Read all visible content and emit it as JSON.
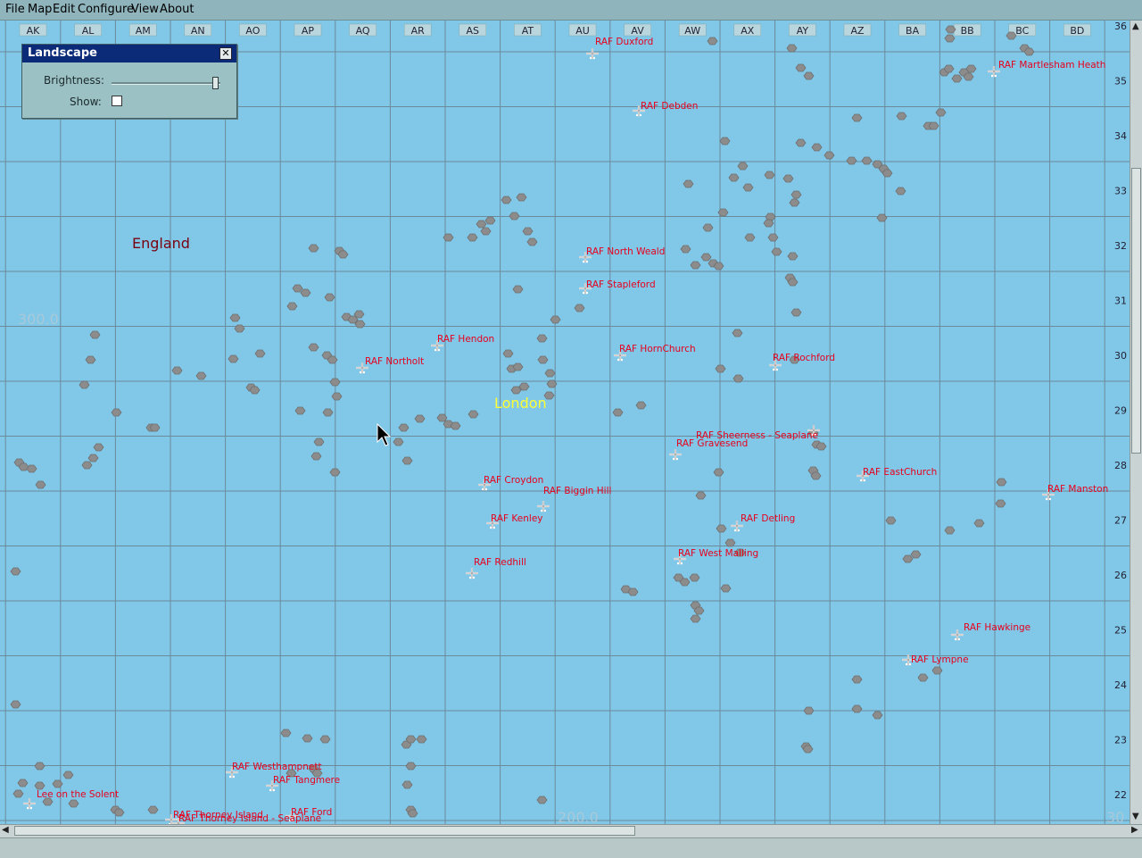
{
  "menu": [
    "File",
    "Map",
    "Edit",
    "Configure",
    "View",
    "About"
  ],
  "grid": {
    "columns": [
      "AK",
      "AL",
      "AM",
      "AN",
      "AO",
      "AP",
      "AQ",
      "AR",
      "AS",
      "AT",
      "AU",
      "AV",
      "AW",
      "AX",
      "AY",
      "AZ",
      "BA",
      "BB",
      "BC",
      "BD"
    ],
    "rows": [
      "36",
      "35",
      "34",
      "33",
      "32",
      "31",
      "30",
      "29",
      "28",
      "27",
      "26",
      "25",
      "24",
      "23",
      "22"
    ],
    "coord_labels": [
      "300.0",
      "200.0",
      "30"
    ]
  },
  "regions": [
    {
      "name": "England",
      "color": "#7a0010"
    },
    {
      "name": "London",
      "color": "#ffff33"
    }
  ],
  "airfields": [
    {
      "name": "RAF Duxford"
    },
    {
      "name": "RAF Martlesham Heath"
    },
    {
      "name": "RAF Debden"
    },
    {
      "name": "RAF North Weald"
    },
    {
      "name": "RAF Stapleford"
    },
    {
      "name": "RAF Hendon"
    },
    {
      "name": "RAF Northolt"
    },
    {
      "name": "RAF HornChurch"
    },
    {
      "name": "RAF Rochford"
    },
    {
      "name": "RAF Sheerness - Seaplane"
    },
    {
      "name": "RAF Gravesend"
    },
    {
      "name": "RAF Croydon"
    },
    {
      "name": "RAF Biggin Hill"
    },
    {
      "name": "RAF EastChurch"
    },
    {
      "name": "RAF Manston"
    },
    {
      "name": "RAF Kenley"
    },
    {
      "name": "RAF Detling"
    },
    {
      "name": "RAF Redhill"
    },
    {
      "name": "RAF West Malling"
    },
    {
      "name": "RAF Hawkinge"
    },
    {
      "name": "RAF Lympne"
    },
    {
      "name": "RAF Westhampnett"
    },
    {
      "name": "RAF Tangmere"
    },
    {
      "name": "Lee on the Solent"
    },
    {
      "name": "RAF Thorney Island"
    },
    {
      "name": "RAF Thorney Island - Seaplane"
    },
    {
      "name": "RAF Ford"
    }
  ],
  "panel": {
    "title": "Landscape",
    "brightness_label": "Brightness:",
    "brightness_value": 0.95,
    "show_label": "Show:",
    "show_checked": false
  },
  "colors": {
    "map_bg": "#80c7e8",
    "grid_line": "#6b8a9a",
    "airfield_text": "#e8001c"
  }
}
